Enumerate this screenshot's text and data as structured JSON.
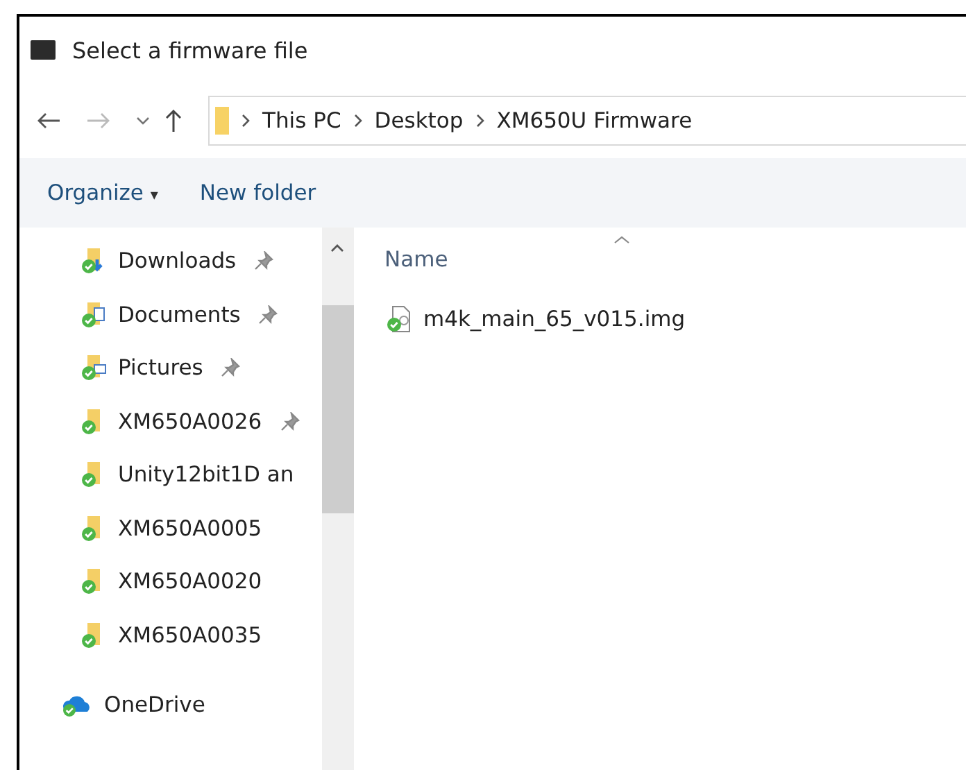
{
  "window": {
    "title": "Select a firmware file"
  },
  "address_bar": {
    "path": [
      {
        "label": "This PC"
      },
      {
        "label": "Desktop"
      },
      {
        "label": "XM650U Firmware"
      }
    ]
  },
  "toolbar": {
    "organize": "Organize",
    "organize_caret": "▾",
    "new_folder": "New folder"
  },
  "sidebar": {
    "items": [
      {
        "kind": "downloads",
        "label": "Downloads",
        "pinned": true
      },
      {
        "kind": "documents",
        "label": "Documents",
        "pinned": true
      },
      {
        "kind": "pictures",
        "label": "Pictures",
        "pinned": true
      },
      {
        "kind": "folder",
        "label": "XM650A0026",
        "pinned": true
      },
      {
        "kind": "folder",
        "label": "Unity12bit1D an",
        "pinned": false
      },
      {
        "kind": "folder",
        "label": "XM650A0005",
        "pinned": false
      },
      {
        "kind": "folder",
        "label": "XM650A0020",
        "pinned": false
      },
      {
        "kind": "folder",
        "label": "XM650A0035",
        "pinned": false
      },
      {
        "kind": "cloud",
        "label": "OneDrive",
        "pinned": false
      }
    ]
  },
  "file_list": {
    "columns": [
      "Name"
    ],
    "files": [
      {
        "name": "m4k_main_65_v015.img"
      }
    ]
  }
}
